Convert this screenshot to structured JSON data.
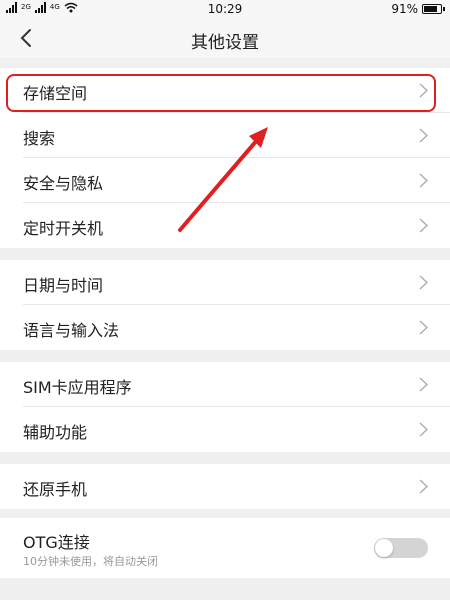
{
  "status_bar": {
    "sim1": "2G",
    "sim2": "4G",
    "time": "10:29",
    "battery_text": "91%",
    "battery_level": 0.91
  },
  "header": {
    "title": "其他设置"
  },
  "groups": [
    {
      "items": [
        {
          "label": "存储空间"
        },
        {
          "label": "搜索"
        },
        {
          "label": "安全与隐私"
        },
        {
          "label": "定时开关机"
        }
      ]
    },
    {
      "items": [
        {
          "label": "日期与时间"
        },
        {
          "label": "语言与输入法"
        }
      ]
    },
    {
      "items": [
        {
          "label": "SIM卡应用程序"
        },
        {
          "label": "辅助功能"
        }
      ]
    },
    {
      "items": [
        {
          "label": "还原手机"
        }
      ]
    }
  ],
  "otg": {
    "label": "OTG连接",
    "sublabel": "10分钟未使用，将自动关闭",
    "enabled": false
  },
  "annotation": {
    "color": "#e02020"
  }
}
